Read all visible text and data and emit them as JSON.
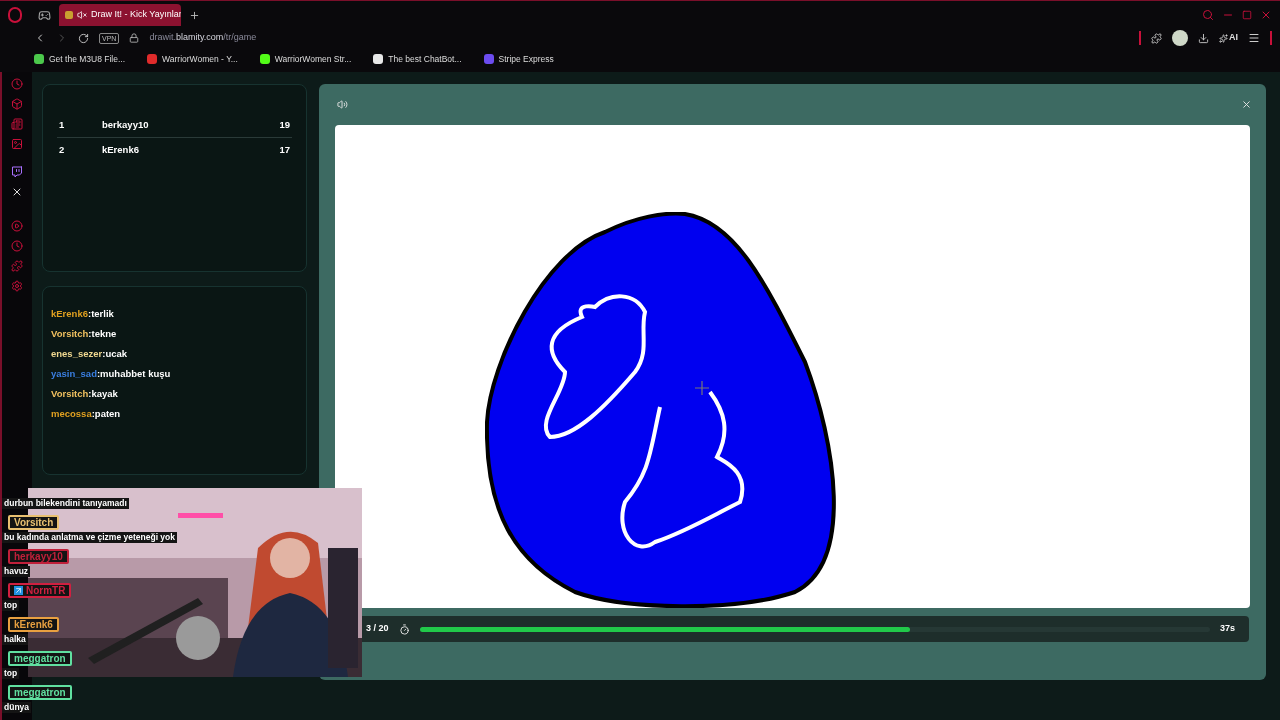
{
  "browser": {
    "tab_title": "Draw It! - Kick Yayınlar",
    "tab_muted": true,
    "url": {
      "prefix": "drawit.",
      "domain": "blamity.com",
      "path": "/tr/game"
    },
    "vpn": "VPN",
    "ai": "AI",
    "bookmarks": [
      {
        "label": "Get the M3U8 File...",
        "color": "#4cc94c"
      },
      {
        "label": "WarriorWomen - Y...",
        "color": "#e02b2b"
      },
      {
        "label": "WarriorWomen Str...",
        "color": "#53fc18"
      },
      {
        "label": "The best ChatBot...",
        "color": "#e8e8e8"
      },
      {
        "label": "Stripe Express",
        "color": "#6c4cf0"
      }
    ]
  },
  "leaderboard": [
    {
      "rank": "1",
      "name": "berkayy10",
      "score": "19"
    },
    {
      "rank": "2",
      "name": "kErenk6",
      "score": "17"
    }
  ],
  "chat": [
    {
      "user": "kErenk6",
      "text": ":terlik",
      "color": "#e0a020"
    },
    {
      "user": "Vorsitch",
      "text": ":tekne",
      "color": "#f0c060"
    },
    {
      "user": "enes_sezer",
      "text": ":ucak",
      "color": "#f0d890"
    },
    {
      "user": "yasin_sad",
      "text": ":muhabbet kuşu",
      "color": "#3a7ee0"
    },
    {
      "user": "Vorsitch",
      "text": ":kayak",
      "color": "#f0c060"
    },
    {
      "user": "mecossa",
      "text": ":paten",
      "color": "#e0a020"
    }
  ],
  "game": {
    "round": "3 / 20",
    "timer": "37s",
    "level": 0.62
  },
  "stream_chat": [
    {
      "text": "durbun bilekendini tanıyamadı"
    },
    {
      "user": "Vorsitch",
      "color": "#e8c070",
      "badge": false,
      "text": "bu kadında anlatma ve çizme yeteneği yok"
    },
    {
      "user": "herkayy10",
      "color": "#c0203a",
      "badge": false,
      "text": "havuz"
    },
    {
      "user": "NormTR",
      "color": "#d02040",
      "badge": true,
      "text": "top"
    },
    {
      "user": "kErenk6",
      "color": "#e8a040",
      "badge": false,
      "text": "halka"
    },
    {
      "user": "meggatron",
      "color": "#60e0a0",
      "badge": false,
      "text": "top"
    },
    {
      "user": "meggatron",
      "color": "#60e0a0",
      "badge": false,
      "text": "dünya"
    }
  ]
}
